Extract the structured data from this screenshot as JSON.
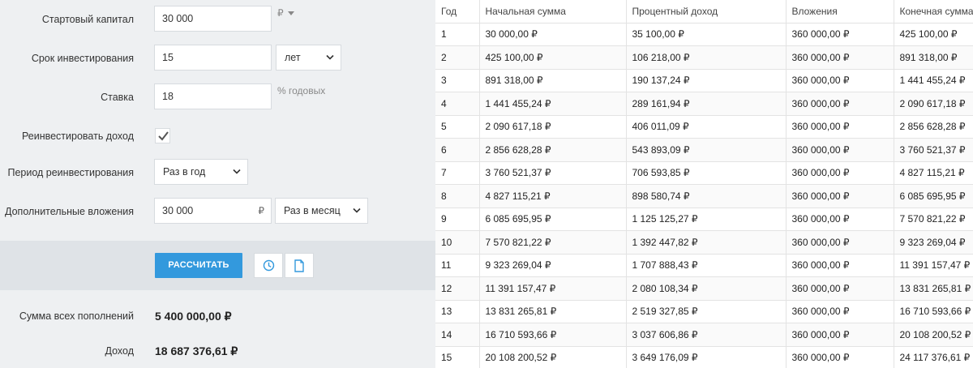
{
  "form": {
    "capital": {
      "label": "Стартовый капитал",
      "value": "30 000",
      "currency": "₽"
    },
    "term": {
      "label": "Срок инвестирования",
      "value": "15",
      "unit": "лет"
    },
    "rate": {
      "label": "Ставка",
      "value": "18",
      "unit": "% годовых"
    },
    "reinvest": {
      "label": "Реинвестировать доход",
      "checked": true
    },
    "reinvest_period": {
      "label": "Период реинвестирования",
      "value": "Раз в год"
    },
    "additional": {
      "label": "Дополнительные вложения",
      "value": "30 000",
      "currency": "₽",
      "period": "Раз в месяц"
    }
  },
  "actions": {
    "calculate_label": "РАССЧИТАТЬ"
  },
  "summary": {
    "total_deposits": {
      "label": "Сумма всех пополнений",
      "value": "5 400 000,00 ₽"
    },
    "income": {
      "label": "Доход",
      "value": "18 687 376,61 ₽"
    }
  },
  "table": {
    "headers": [
      "Год",
      "Начальная сумма",
      "Процентный доход",
      "Вложения",
      "Конечная сумма"
    ],
    "rows": [
      [
        "1",
        "30 000,00 ₽",
        "35 100,00 ₽",
        "360 000,00 ₽",
        "425 100,00 ₽"
      ],
      [
        "2",
        "425 100,00 ₽",
        "106 218,00 ₽",
        "360 000,00 ₽",
        "891 318,00 ₽"
      ],
      [
        "3",
        "891 318,00 ₽",
        "190 137,24 ₽",
        "360 000,00 ₽",
        "1 441 455,24 ₽"
      ],
      [
        "4",
        "1 441 455,24 ₽",
        "289 161,94 ₽",
        "360 000,00 ₽",
        "2 090 617,18 ₽"
      ],
      [
        "5",
        "2 090 617,18 ₽",
        "406 011,09 ₽",
        "360 000,00 ₽",
        "2 856 628,28 ₽"
      ],
      [
        "6",
        "2 856 628,28 ₽",
        "543 893,09 ₽",
        "360 000,00 ₽",
        "3 760 521,37 ₽"
      ],
      [
        "7",
        "3 760 521,37 ₽",
        "706 593,85 ₽",
        "360 000,00 ₽",
        "4 827 115,21 ₽"
      ],
      [
        "8",
        "4 827 115,21 ₽",
        "898 580,74 ₽",
        "360 000,00 ₽",
        "6 085 695,95 ₽"
      ],
      [
        "9",
        "6 085 695,95 ₽",
        "1 125 125,27 ₽",
        "360 000,00 ₽",
        "7 570 821,22 ₽"
      ],
      [
        "10",
        "7 570 821,22 ₽",
        "1 392 447,82 ₽",
        "360 000,00 ₽",
        "9 323 269,04 ₽"
      ],
      [
        "11",
        "9 323 269,04 ₽",
        "1 707 888,43 ₽",
        "360 000,00 ₽",
        "11 391 157,47 ₽"
      ],
      [
        "12",
        "11 391 157,47 ₽",
        "2 080 108,34 ₽",
        "360 000,00 ₽",
        "13 831 265,81 ₽"
      ],
      [
        "13",
        "13 831 265,81 ₽",
        "2 519 327,85 ₽",
        "360 000,00 ₽",
        "16 710 593,66 ₽"
      ],
      [
        "14",
        "16 710 593,66 ₽",
        "3 037 606,86 ₽",
        "360 000,00 ₽",
        "20 108 200,52 ₽"
      ],
      [
        "15",
        "20 108 200,52 ₽",
        "3 649 176,09 ₽",
        "360 000,00 ₽",
        "24 117 376,61 ₽"
      ]
    ]
  },
  "icons": {
    "history": "clock-icon",
    "document": "document-icon",
    "chevron": "chevron-down-icon",
    "check": "checkmark-icon"
  },
  "colors": {
    "accent": "#3399dd",
    "panel_bg": "#eef0f2",
    "action_bar_bg": "#dfe3e7"
  }
}
